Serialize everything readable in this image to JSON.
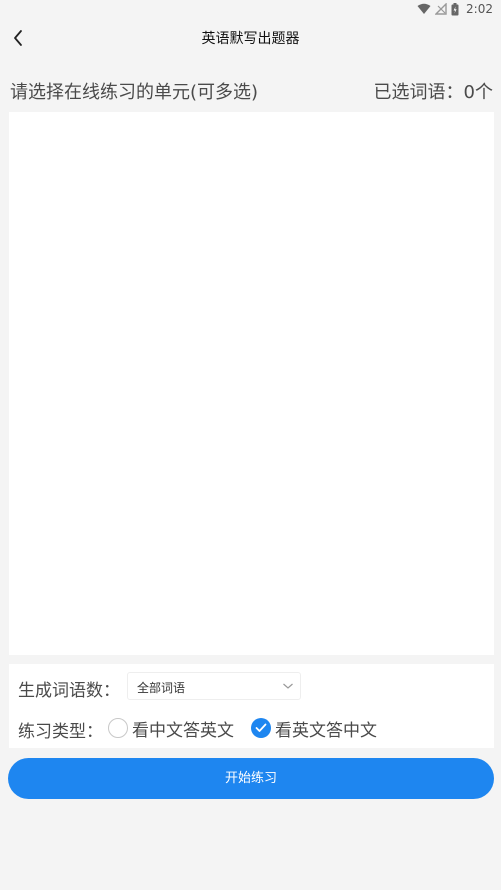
{
  "status_bar": {
    "time": "2:02",
    "icons": [
      "wifi-icon",
      "no-signal-icon",
      "battery-icon"
    ]
  },
  "nav": {
    "title": "英语默写出题器",
    "back_icon": "chevron-left-icon"
  },
  "unit_header": {
    "prompt": "请选择在线练习的单元(可多选)",
    "selected_count": "已选词语：0个"
  },
  "options": {
    "count_label": "生成词语数：",
    "count_value": "全部词语",
    "type_label": "练习类型：",
    "types": [
      {
        "label": "看中文答英文",
        "checked": false
      },
      {
        "label": "看英文答中文",
        "checked": true
      }
    ]
  },
  "actions": {
    "start_label": "开始练习"
  },
  "colors": {
    "accent": "#1e86f0",
    "background": "#f4f4f4",
    "panel": "#ffffff"
  }
}
